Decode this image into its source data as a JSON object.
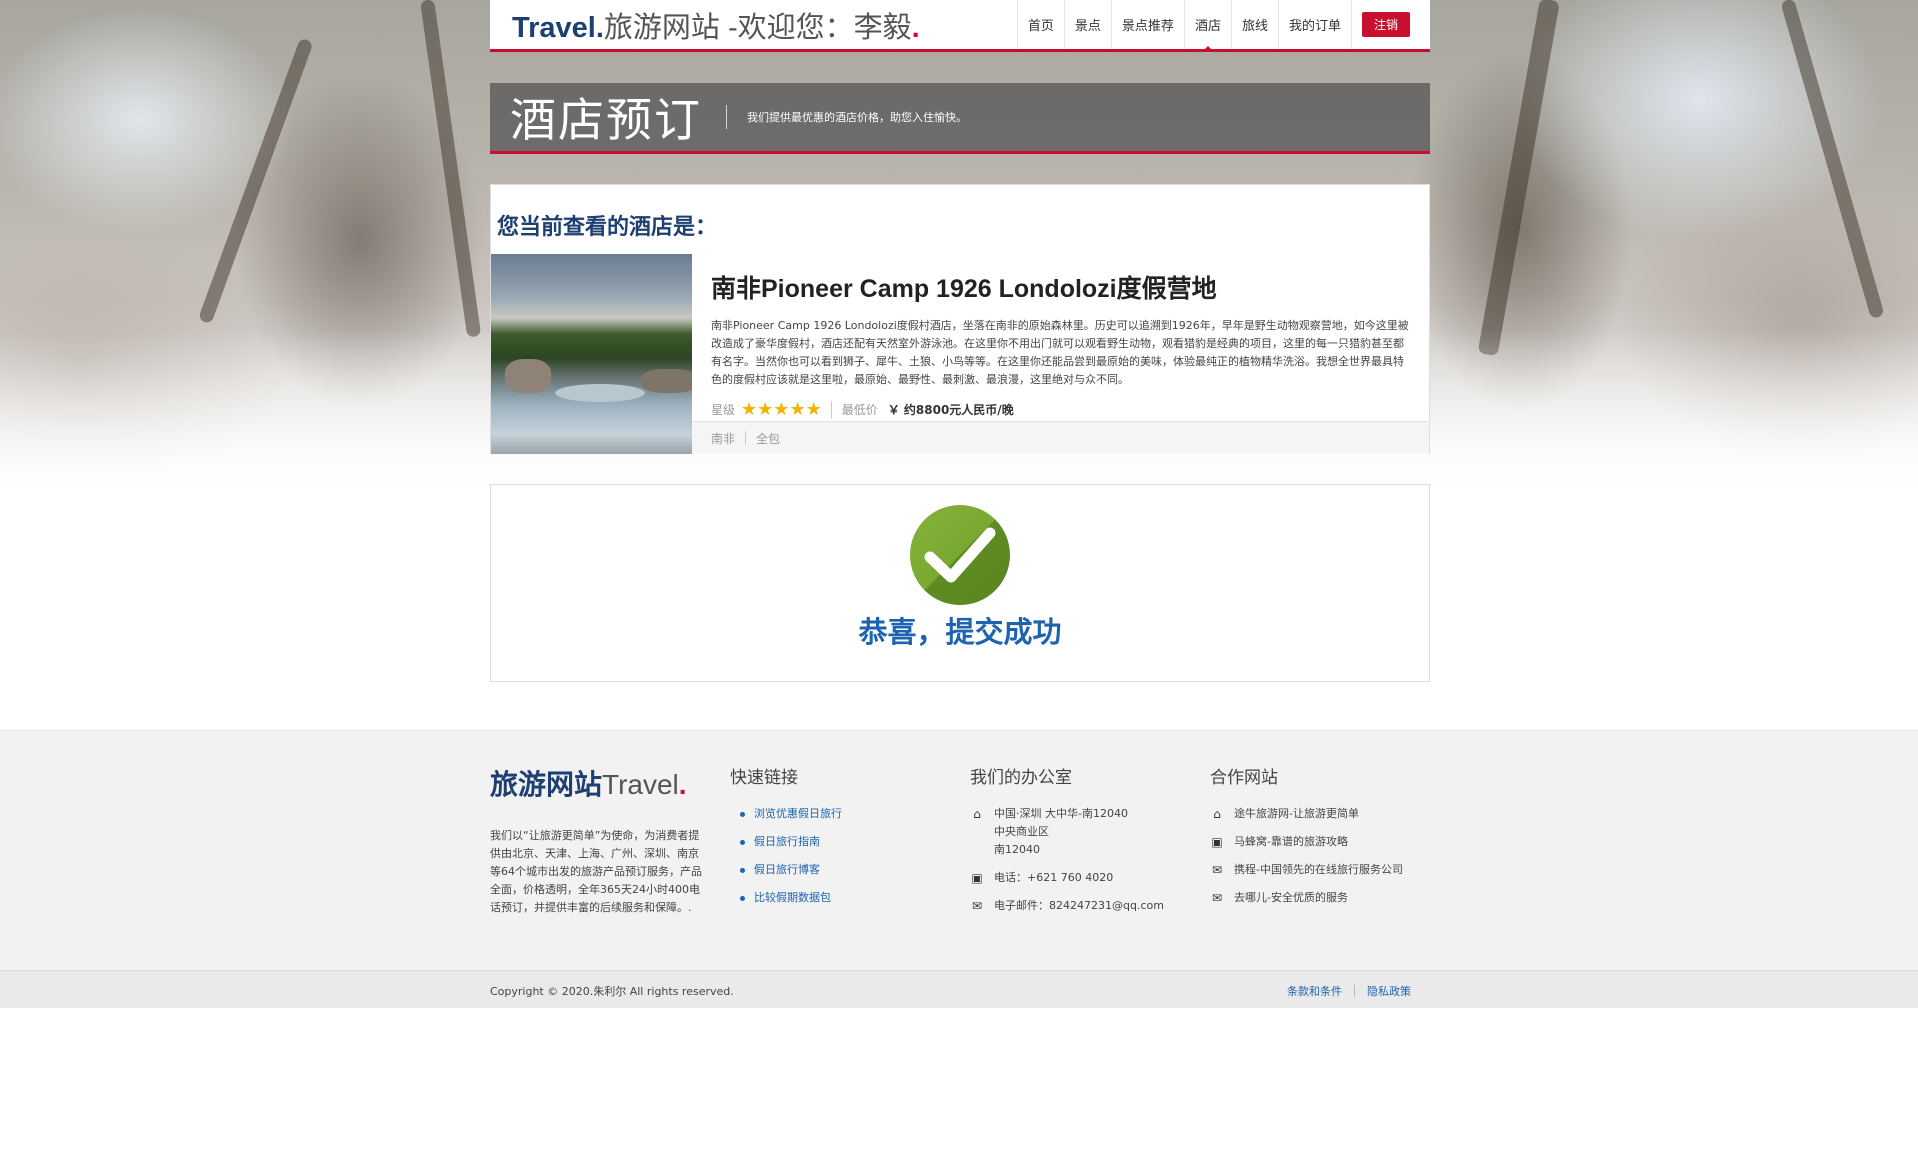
{
  "header": {
    "brand_prefix": "Travel.",
    "brand_rest": "旅游网站 -欢迎您：李毅",
    "brand_dot": ".",
    "nav": [
      "首页",
      "景点",
      "景点推荐",
      "酒店",
      "旅线",
      "我的订单"
    ],
    "active_nav": "酒店",
    "logout_label": "注销"
  },
  "banner": {
    "title": "酒店预订",
    "subtitle": "我们提供最优惠的酒店价格，助您入住愉快。"
  },
  "hotel": {
    "heading": "您当前查看的酒店是：",
    "name": "南非Pioneer Camp 1926 Londolozi度假营地",
    "description": "南非Pioneer Camp 1926 Londolozi度假村酒店，坐落在南非的原始森林里。历史可以追溯到1926年，早年是野生动物观察营地，如今这里被改造成了豪华度假村，酒店还配有天然室外游泳池。在这里你不用出门就可以观看野生动物，观看猎豹是经典的项目，这里的每一只猎豹甚至都有名字。当然你也可以看到狮子、犀牛、土狼、小鸟等等。在这里你还能品尝到最原始的美味，体验最纯正的植物精华洗浴。我想全世界最具特色的度假村应该就是这里啦，最原始、最野性、最刺激、最浪漫，这里绝对与众不同。",
    "star_label": "星级",
    "stars": 5,
    "price_label": "最低价",
    "price": "￥ 约8800元人民币/晚",
    "tags": [
      "南非",
      "全包"
    ]
  },
  "success": {
    "message": "恭喜，提交成功"
  },
  "footer": {
    "logo_cn": "旅游网站",
    "logo_en": "Travel",
    "logo_dot": ".",
    "about": "我们以“让旅游更简单”为使命，为消费者提供由北京、天津、上海、广州、深圳、南京等64个城市出发的旅游产品预订服务，产品全面，价格透明，全年365天24小时400电话预订，并提供丰富的后续服务和保障。.",
    "links_title": "快速链接",
    "links": [
      "浏览优惠假日旅行",
      "假日旅行指南",
      "假日旅行博客",
      "比较假期数据包"
    ],
    "office_title": "我们的办公室",
    "office": {
      "address_lines": [
        "中国·深圳 大中华-南12040",
        "中央商业区",
        "南12040"
      ],
      "phone": "电话：+621 760 4020",
      "email": "电子邮件：824247231@qq.com"
    },
    "partners_title": "合作网站",
    "partners": [
      "途牛旅游网-让旅游更简单",
      "马蜂窝-靠谱的旅游攻略",
      "携程-中国领先的在线旅行服务公司",
      "去哪儿-安全优质的服务"
    ],
    "copyright": "Copyright © 2020.朱利尔 All rights reserved.",
    "terms": "条款和条件",
    "privacy": "隐私政策"
  },
  "colors": {
    "accent": "#c8102e",
    "brand_blue": "#1d3f72",
    "link_blue": "#1e63b0",
    "success_green": "#7aa934"
  }
}
